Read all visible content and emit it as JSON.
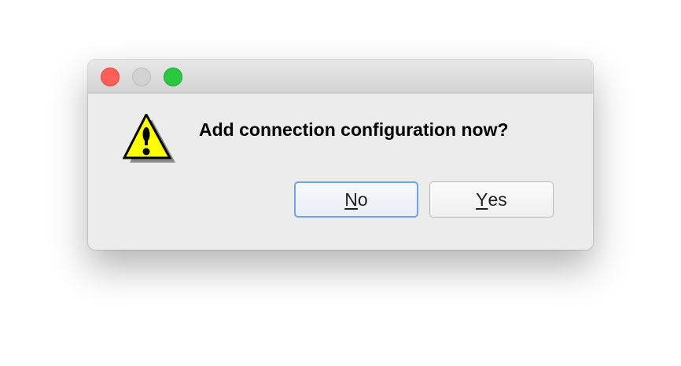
{
  "window": {
    "controls": {
      "close": "close",
      "minimize": "minimize",
      "zoom": "zoom"
    }
  },
  "dialog": {
    "icon": "warning-icon",
    "message": "Add connection configuration now?"
  },
  "buttons": {
    "no": {
      "mnemonic": "N",
      "rest": "o"
    },
    "yes": {
      "mnemonic": "Y",
      "rest": "es"
    }
  },
  "colors": {
    "close": "#fe5f57",
    "zoom": "#2ac840",
    "focus": "#6ea1e6",
    "warning": "#ffff00"
  }
}
